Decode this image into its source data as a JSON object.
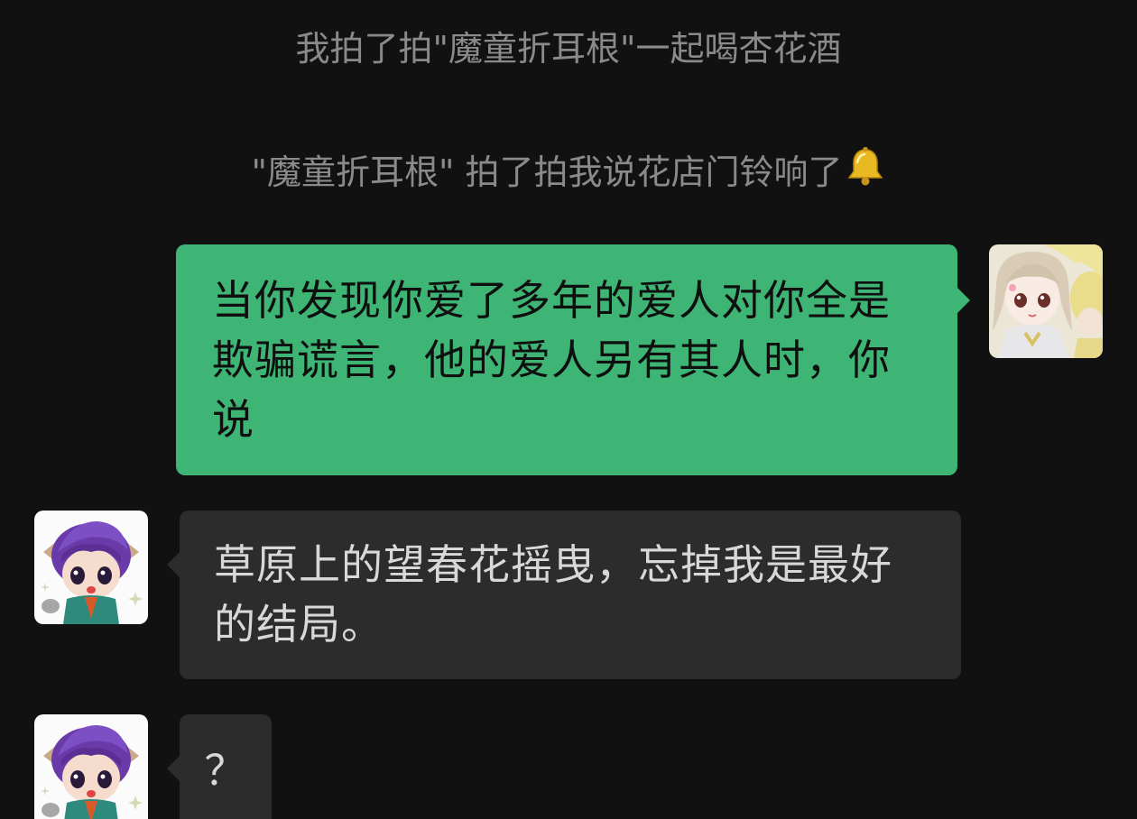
{
  "system_messages": [
    "我拍了拍\"魔童折耳根\"一起喝杏花酒",
    "\"魔童折耳根\" 拍了拍我说花店门铃响了"
  ],
  "system_icons": [
    "bell-icon"
  ],
  "messages": [
    {
      "direction": "outgoing",
      "text": "当你发现你爱了多年的爱人对你全是欺骗谎言，他的爱人另有其人时，你说",
      "avatar_icon": "doll-avatar"
    },
    {
      "direction": "incoming",
      "text": "草原上的望春花摇曳，忘掉我是最好的结局。",
      "avatar_icon": "nezha-avatar"
    },
    {
      "direction": "incoming",
      "text": "？",
      "avatar_icon": "nezha-avatar"
    }
  ],
  "colors": {
    "background": "#111111",
    "outgoing_bubble": "#3eb575",
    "incoming_bubble": "#2c2c2c",
    "system_text": "#8a8a8a"
  }
}
